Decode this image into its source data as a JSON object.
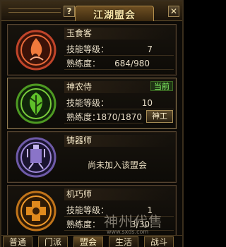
{
  "window": {
    "title": "江湖盟会",
    "help_label": "?",
    "close_label": "✕"
  },
  "cards": [
    {
      "name": "玉食客",
      "emblem": "flame-crest-icon",
      "emblem_color": "#d8552b",
      "skill_label": "技能等级：",
      "skill_value": "7",
      "prof_label": "熟练度：",
      "prof_value": "684/980"
    },
    {
      "name": "神农侍",
      "emblem": "herb-crest-icon",
      "emblem_color": "#5fbf2a",
      "status": "当前",
      "skill_label": "技能等级：",
      "skill_value": "10",
      "prof_label": "熟练度：",
      "prof_value": "1870/1870",
      "action_label": "神工"
    },
    {
      "name": "铸器师",
      "emblem": "forge-crest-icon",
      "emblem_color": "#8a74c8",
      "notice": "尚未加入该盟会"
    },
    {
      "name": "机巧师",
      "emblem": "gear-crest-icon",
      "emblem_color": "#e08a1e",
      "skill_label": "技能等级：",
      "skill_value": "1",
      "prof_label": "熟练度：",
      "prof_value": "3/30"
    }
  ],
  "tabs": [
    "普通",
    "门派",
    "盟会",
    "生活",
    "战斗"
  ],
  "selected_tab": "盟会",
  "watermark": {
    "text": "神州代售",
    "sub": "www.sxds.com"
  }
}
